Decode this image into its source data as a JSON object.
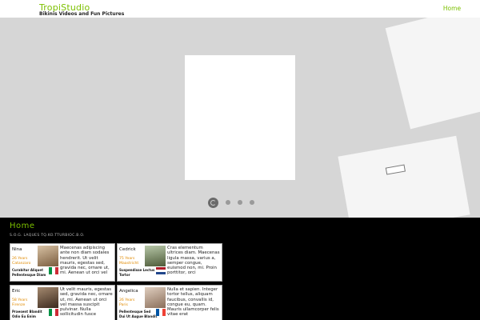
{
  "header": {
    "logo": "TropiStudio",
    "tagline": "Bikinis Videos and Fun Pictures",
    "nav_home": "Home"
  },
  "hero": {
    "slide_count": 4,
    "active_slide": 1
  },
  "content": {
    "title": "Home",
    "subtitle": "S.O.G. LAQUES TQ.KO.TTURBIOC.B.O."
  },
  "profiles": [
    {
      "name": "Nina",
      "age": "26 Years",
      "city": "Catanzaro",
      "tag1": "Curabitur Aliquet",
      "tag2": "Pellentesque Diam",
      "flag": "italy",
      "desc": "Maecenas adipiscing ante non diam sodales hendrerit. Ut velit mauris, egestas sed, gravida nec, ornare ut, mi. Aenean ut orci vel"
    },
    {
      "name": "Cedrick",
      "age": "75 Years",
      "city": "Maastricht",
      "tag1": "Suspendisse Lectus",
      "tag2": "Tortor",
      "flag": "netherlands",
      "desc": "Cras elementum ultrices diam. Maecenas ligula massa, varius a, semper congue, euismod non, mi. Proin porttitor, orci"
    },
    {
      "name": "Eric",
      "age": "58 Years",
      "city": "Firenze",
      "tag1": "Praesent Blandit",
      "tag2": "Odio Eu Enim",
      "flag": "italy",
      "desc": "Ut velit mauris, egestas sed, gravida nec, ornare ut, mi. Aenean ut orci vel massa suscipit pulvinar. Nulla sollicitudin fusce"
    },
    {
      "name": "Angelica",
      "age": "26 Years",
      "city": "Paris",
      "tag1": "Pellentesque Sed",
      "tag2": "Dui Ut Augue Blandit",
      "flag": "france",
      "desc": "Nulla et sapien. Integer tortor tellus, aliquam faucibus, convallis id, congue eu, quam. Mauris ullamcorper felis vitae erat"
    }
  ]
}
